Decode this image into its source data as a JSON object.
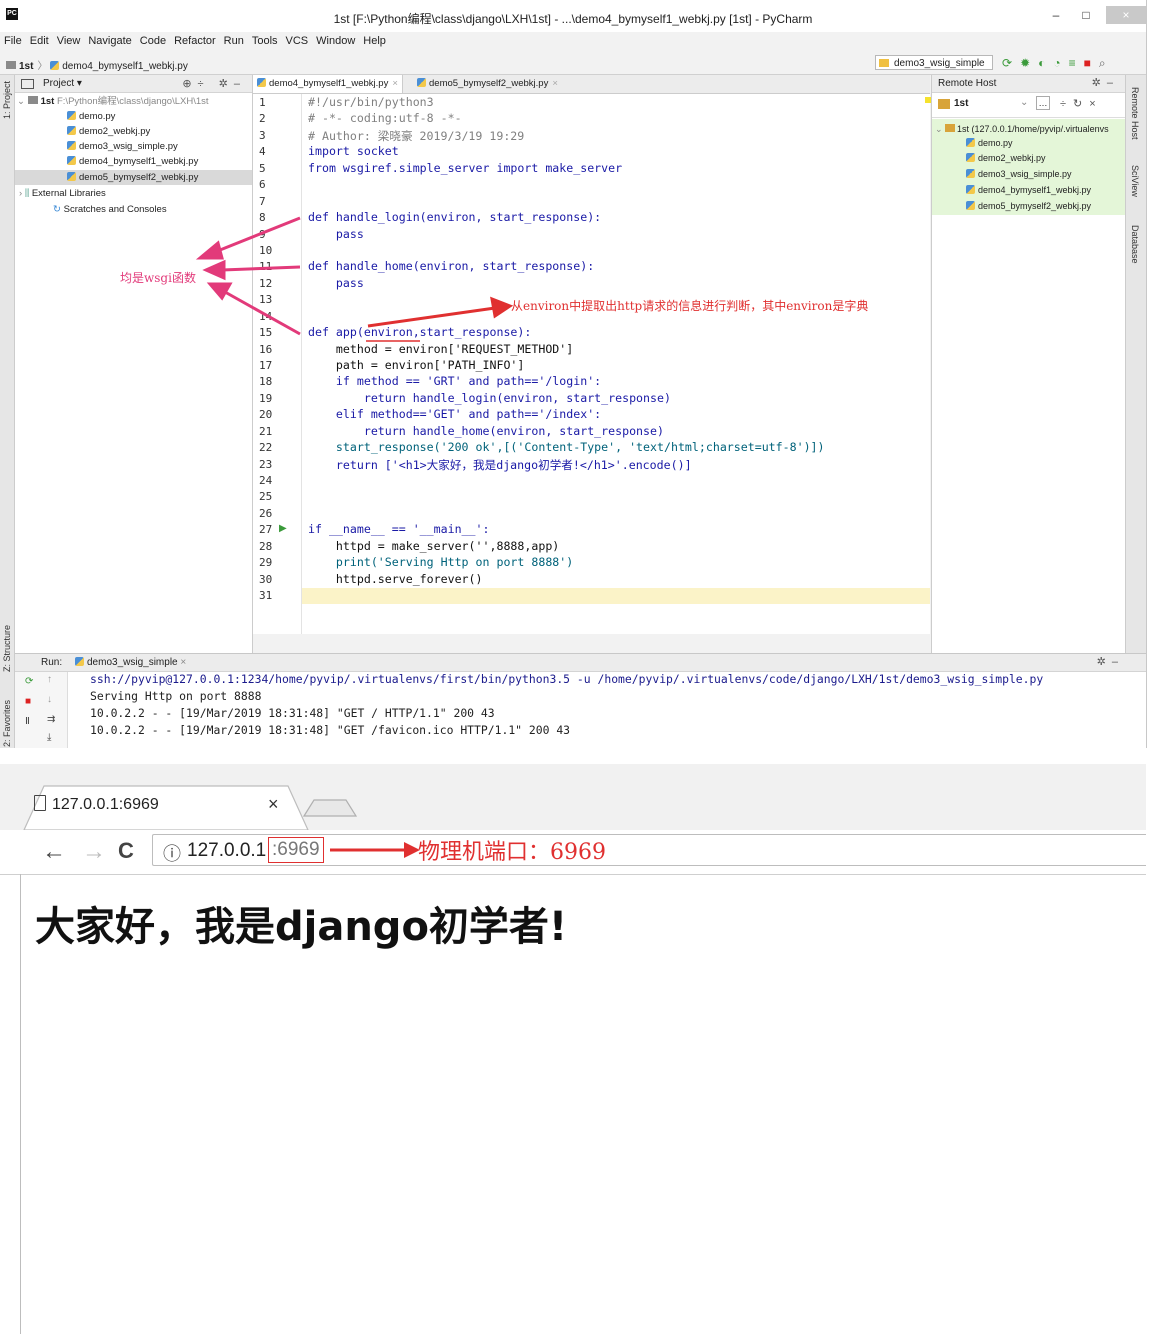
{
  "ide": {
    "window_title": "1st [F:\\Python编程\\class\\django\\LXH\\1st] - ...\\demo4_bymyself1_webkj.py [1st] - PyCharm",
    "app_logo": "PC",
    "window_controls": {
      "minimize": "–",
      "maximize": "□",
      "close": "×"
    },
    "menu": [
      "File",
      "Edit",
      "View",
      "Navigate",
      "Code",
      "Refactor",
      "Run",
      "Tools",
      "VCS",
      "Window",
      "Help"
    ],
    "breadcrumb": {
      "project": "1st",
      "file": "demo4_bymyself1_webkj.py"
    },
    "run_config": "demo3_wsig_simple",
    "toolbar_icons": [
      "rerun-icon",
      "debug-icon",
      "coverage-icon",
      "profile-icon",
      "build-icon",
      "stop-icon",
      "search-icon"
    ],
    "left_strip": {
      "project": "1: Project",
      "structure": "Z: Structure",
      "favorites": "2: Favorites"
    },
    "right_strip": {
      "remote_host": "Remote Host",
      "sciview": "SciView",
      "database": "Database"
    },
    "project_panel": {
      "title": "Project",
      "root_name": "1st",
      "root_path": "F:\\Python编程\\class\\django\\LXH\\1st",
      "files": [
        "demo.py",
        "demo2_webkj.py",
        "demo3_wsig_simple.py",
        "demo4_bymyself1_webkj.py",
        "demo5_bymyself2_webkj.py"
      ],
      "selected_file": "demo5_bymyself2_webkj.py",
      "external": "External Libraries",
      "scratches": "Scratches and Consoles"
    },
    "editor_tabs": [
      {
        "label": "demo4_bymyself1_webkj.py",
        "active": true
      },
      {
        "label": "demo5_bymyself2_webkj.py",
        "active": false
      }
    ],
    "code_lines": [
      "#!/usr/bin/python3",
      "# -*- coding:utf-8 -*-",
      "# Author: 梁晓豪 2019/3/19 19:29",
      "import socket",
      "from wsgiref.simple_server import make_server",
      "",
      "",
      "def handle_login(environ, start_response):",
      "    pass",
      "",
      "def handle_home(environ, start_response):",
      "    pass",
      "",
      "",
      "def app(environ,start_response):",
      "    method = environ['REQUEST_METHOD']",
      "    path = environ['PATH_INFO']",
      "    if method == 'GRT' and path=='/login':",
      "        return handle_login(environ, start_response)",
      "    elif method=='GET' and path=='/index':",
      "        return handle_home(environ, start_response)",
      "    start_response('200 ok',[('Content-Type', 'text/html;charset=utf-8')])",
      "    return ['<h1>大家好，我是django初学者!</h1>'.encode()]",
      "",
      "",
      "",
      "if __name__ == '__main__':",
      "    httpd = make_server('',8888,app)",
      "    print('Serving Http on port 8888')",
      "    httpd.serve_forever()",
      ""
    ],
    "annotations": {
      "wsgi_functions": "均是wsgi函数",
      "environ_note": "从environ中提取出http请求的信息进行判断，其中environ是字典"
    },
    "remote_host": {
      "title": "Remote Host",
      "server": "1st",
      "root": "1st (127.0.0.1/home/pyvip/.virtualenvs",
      "files": [
        "demo.py",
        "demo2_webkj.py",
        "demo3_wsig_simple.py",
        "demo4_bymyself1_webkj.py",
        "demo5_bymyself2_webkj.py"
      ]
    },
    "run_panel": {
      "label": "Run:",
      "tab": "demo3_wsig_simple",
      "output": [
        "ssh://pyvip@127.0.0.1:1234/home/pyvip/.virtualenvs/first/bin/python3.5 -u /home/pyvip/.virtualenvs/code/django/LXH/1st/demo3_wsig_simple.py",
        "Serving Http on port 8888",
        "10.0.2.2 - - [19/Mar/2019 18:31:48] \"GET / HTTP/1.1\" 200 43",
        "10.0.2.2 - - [19/Mar/2019 18:31:48] \"GET /favicon.ico HTTP/1.1\" 200 43"
      ]
    }
  },
  "browser": {
    "tab_title": "127.0.0.1:6969",
    "tab_close": "×",
    "url_host": "127.0.0.1",
    "url_port": ":6969",
    "port_annotation": "物理机端口：6969",
    "page_heading": "大家好，我是django初学者!",
    "nav": {
      "back": "←",
      "forward": "→",
      "reload": "C",
      "info": "ⓘ"
    }
  },
  "colors": {
    "annotation_pink": "#e23a7a",
    "annotation_red": "#e03030",
    "current_line": "#fbf3c8",
    "remote_highlight": "#e4f6d8"
  }
}
